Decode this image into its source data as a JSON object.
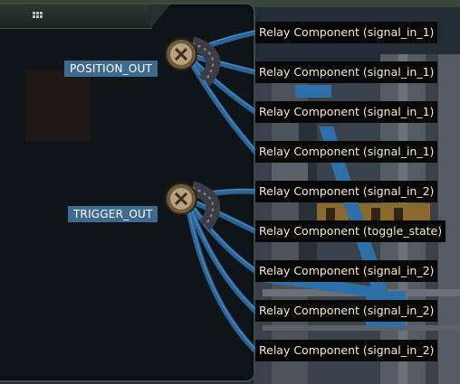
{
  "panel": {
    "grip_icon": "grip-dots-icon"
  },
  "pins": [
    {
      "label": "POSITION_OUT"
    },
    {
      "label": "TRIGGER_OUT"
    }
  ],
  "connections": [
    {
      "label": "Relay Component (signal_in_1)"
    },
    {
      "label": "Relay Component (signal_in_1)"
    },
    {
      "label": "Relay Component (signal_in_1)"
    },
    {
      "label": "Relay Component (signal_in_1)"
    },
    {
      "label": "Relay Component (signal_in_2)"
    },
    {
      "label": "Relay Component (toggle_state)"
    },
    {
      "label": "Relay Component (signal_in_2)"
    },
    {
      "label": "Relay Component (signal_in_2)"
    },
    {
      "label": "Relay Component (signal_in_2)"
    }
  ],
  "colors": {
    "wire": "#2f6fa8",
    "pin_label_bg": "#3f6a8f",
    "relay_label_bg": "#080808",
    "relay_label_text": "#f2ead2"
  }
}
